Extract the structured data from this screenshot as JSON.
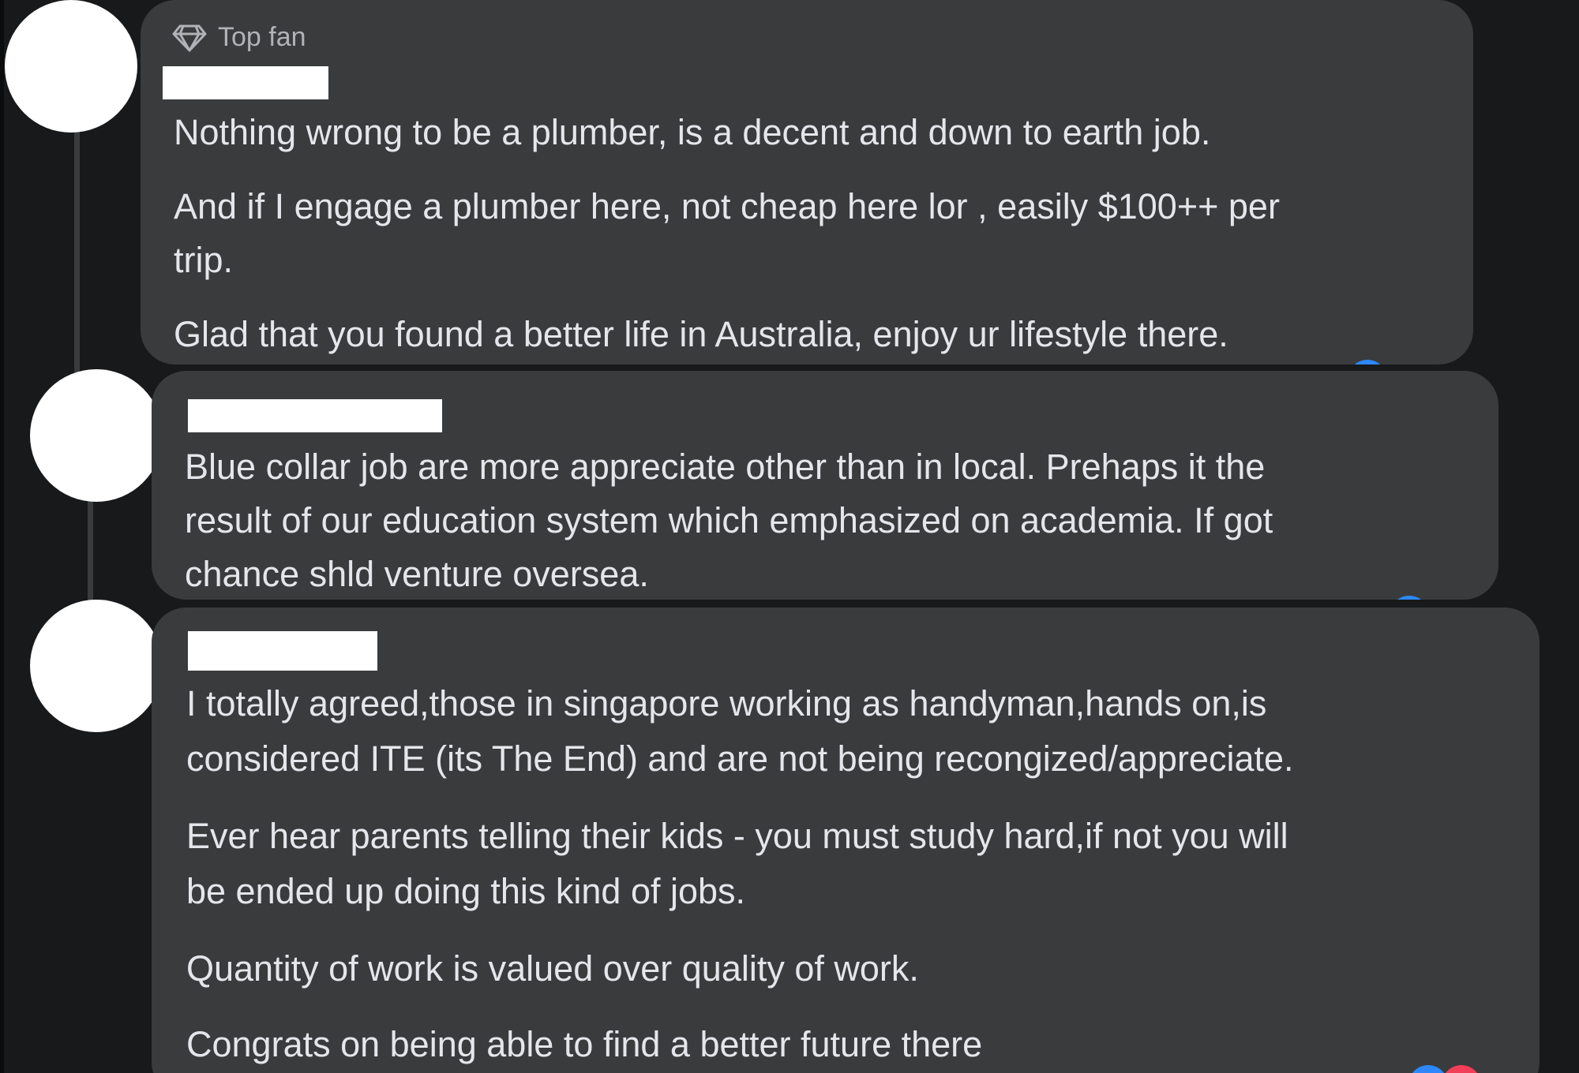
{
  "thread": {
    "comments": [
      {
        "badge": "Top fan",
        "badge_icon": "diamond-icon",
        "author": "",
        "paragraphs": [
          "Nothing wrong to be a plumber, is a decent and down to earth job.",
          "And if I engage a plumber here, not cheap here lor , easily $100++ per",
          "trip.",
          "Glad that you found a better life in Australia, enjoy ur lifestyle there."
        ]
      },
      {
        "author": "",
        "paragraphs": [
          "Blue collar job are more appreciate other than in local. Prehaps it the",
          "result of our education system which emphasized on academia. If got",
          "chance shld venture oversea."
        ]
      },
      {
        "author": "",
        "paragraphs": [
          "I totally agreed,those in singapore working as handyman,hands on,is",
          "considered ITE (its The End) and are not being recongized/appreciate.",
          "Ever hear parents telling their kids - you must study hard,if not you will",
          "be ended up doing this kind of jobs.",
          "Quantity of work is valued over quality of work.",
          "Congrats on being able to find a better future there"
        ]
      }
    ]
  },
  "colors": {
    "background": "#18191a",
    "bubble": "#3a3b3c",
    "text": "#e4e6eb",
    "muted": "#b0b3b8",
    "like_blue": "#2d88ff",
    "love_red": "#f33e58"
  }
}
